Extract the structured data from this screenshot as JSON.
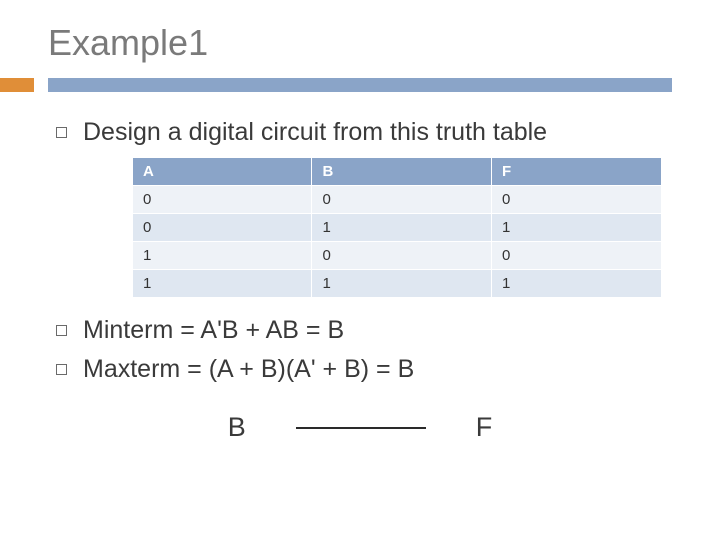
{
  "slide": {
    "title": "Example1"
  },
  "bullets": {
    "design": "Design a digital circuit from this truth table",
    "minterm": "Minterm = A'B + AB = B",
    "maxterm": "Maxterm = (A + B)(A' + B) = B"
  },
  "table": {
    "headers": {
      "a": "A",
      "b": "B",
      "f": "F"
    },
    "rows": [
      {
        "a": "0",
        "b": "0",
        "f": "0"
      },
      {
        "a": "0",
        "b": "1",
        "f": "1"
      },
      {
        "a": "1",
        "b": "0",
        "f": "0"
      },
      {
        "a": "1",
        "b": "1",
        "f": "1"
      }
    ]
  },
  "circuit": {
    "input": "B",
    "output": "F"
  }
}
